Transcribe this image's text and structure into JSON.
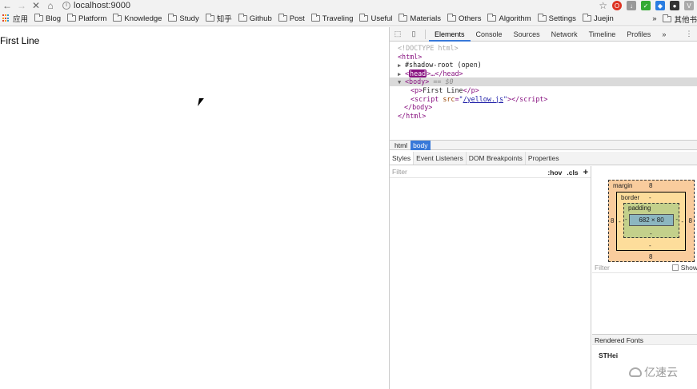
{
  "browser": {
    "url": "localhost:9000",
    "extensions": [
      "opera-icon",
      "download-icon",
      "shield-icon",
      "dropbox-icon",
      "ghost-icon",
      "vivaldi-icon"
    ]
  },
  "bookmarks": {
    "apps_label": "应用",
    "items": [
      "Blog",
      "Platform",
      "Knowledge",
      "Study",
      "知乎",
      "Github",
      "Post",
      "Traveling",
      "Useful",
      "Materials",
      "Others",
      "Algorithm",
      "Settings",
      "Juejin"
    ],
    "more_label": "»",
    "other_label": "其他书"
  },
  "page": {
    "content": "First Line"
  },
  "devtools": {
    "tabs": [
      "Elements",
      "Console",
      "Sources",
      "Network",
      "Timeline",
      "Profiles"
    ],
    "active_tab": "Elements",
    "more_tabs": "»",
    "dom": {
      "doctype": "<!DOCTYPE html>",
      "html_open": "<html>",
      "shadow": "#shadow-root (open)",
      "head_tag": "head",
      "head_rest": "…</head>",
      "body_tag": "body",
      "body_eq": "== $0",
      "p_text": "First Line",
      "script_src": "/yellow.js",
      "body_close": "</body>",
      "html_close": "</html>"
    },
    "breadcrumbs": [
      "html",
      "body"
    ],
    "sub_tabs": [
      "Styles",
      "Event Listeners",
      "DOM Breakpoints",
      "Properties"
    ],
    "filter_placeholder": "Filter",
    "hov": ":hov",
    "cls": ".cls",
    "add": "+",
    "box_model": {
      "margin_label": "margin",
      "margin_top": "8",
      "margin_bottom": "8",
      "margin_left": "8",
      "margin_right": "8",
      "border_label": "border",
      "border_value": "-",
      "padding_label": "padding",
      "padding_value": "-",
      "content_size": "682 × 80"
    },
    "computed_filter": "Filter",
    "show_label": "Show",
    "rendered_fonts": "Rendered Fonts",
    "font_name": "STHei"
  },
  "watermark": "亿速云"
}
